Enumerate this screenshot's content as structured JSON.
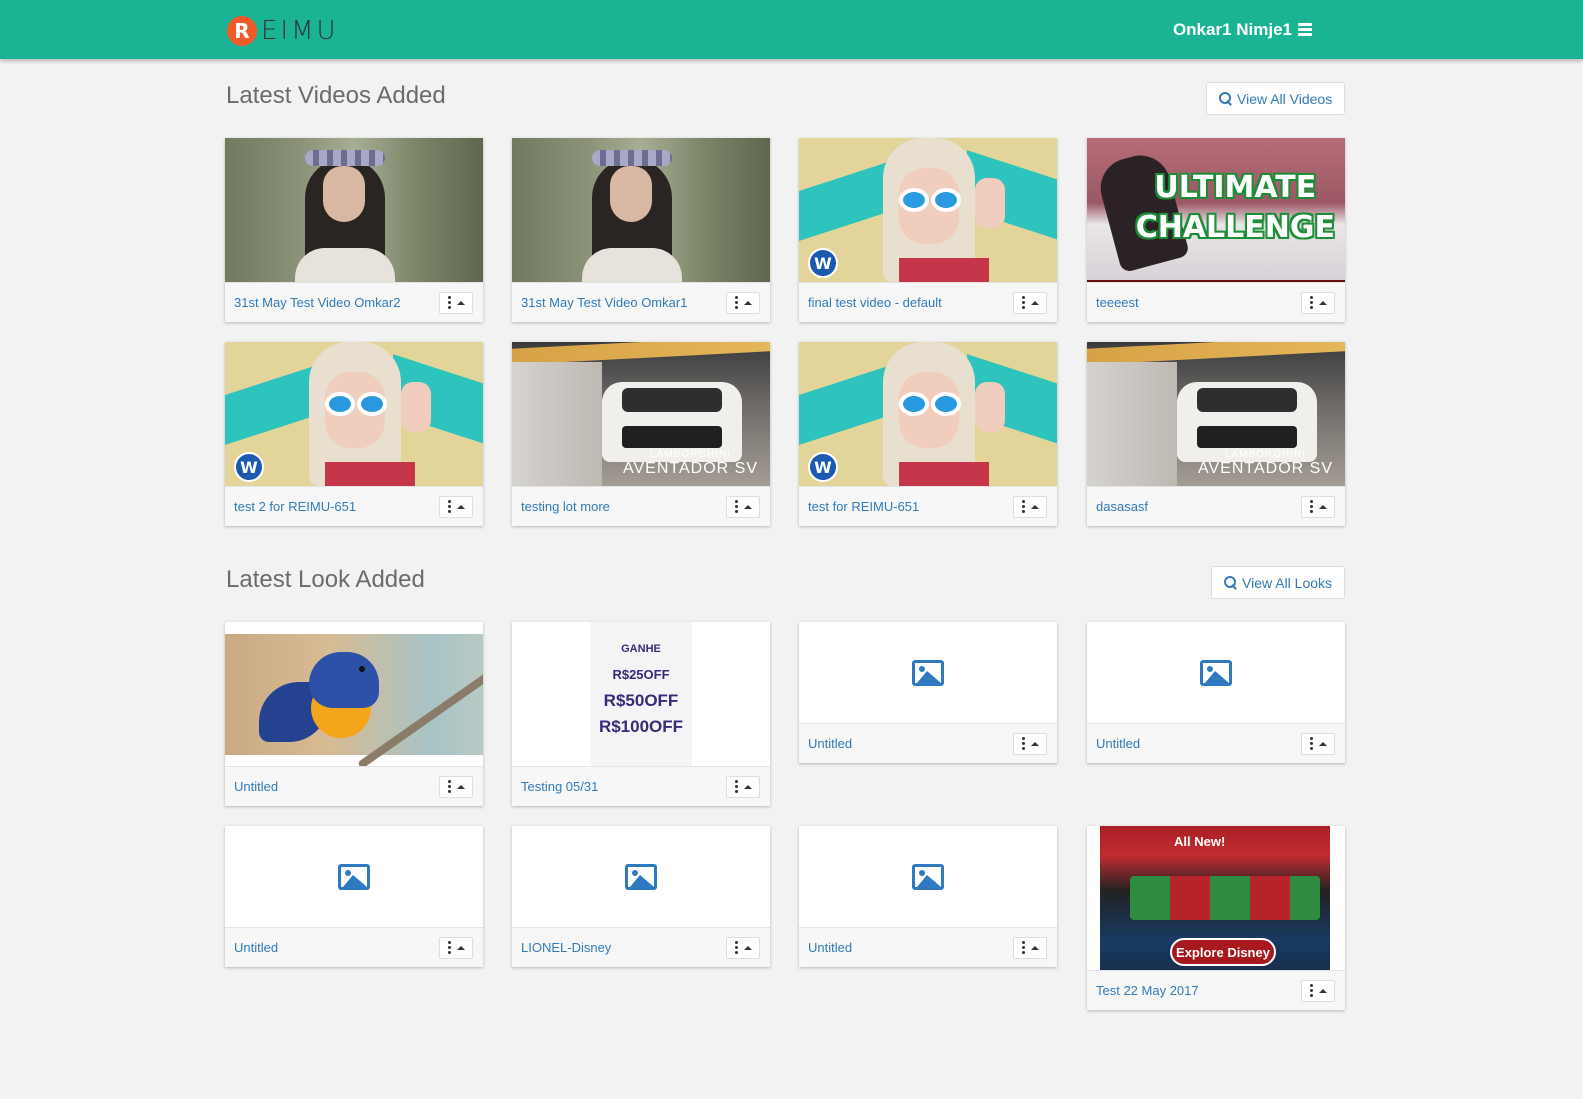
{
  "header": {
    "logo_letter": "R",
    "logo_text": "EIMU",
    "user_name": "Onkar1 Nimje1",
    "menu_icon": "bars-icon",
    "bg_color": "#1ab394"
  },
  "videos_section": {
    "title": "Latest Videos Added",
    "view_all_label": "View All Videos",
    "items": [
      {
        "title": "31st May Test Video Omkar2",
        "thumb": "forest-woman"
      },
      {
        "title": "31st May Test Video Omkar1",
        "thumb": "forest-woman"
      },
      {
        "title": "final test video - default",
        "thumb": "blonde-sunglasses"
      },
      {
        "title": "teeeest",
        "thumb": "ultimate-challenge"
      },
      {
        "title": "test 2 for REIMU-651",
        "thumb": "blonde-sunglasses"
      },
      {
        "title": "testing lot more",
        "thumb": "lamborghini"
      },
      {
        "title": "test for REIMU-651",
        "thumb": "blonde-sunglasses"
      },
      {
        "title": "dasasasf",
        "thumb": "lamborghini"
      }
    ],
    "overlay_texts": {
      "ultimate_line1": "ULTIMATE",
      "ultimate_line2": "CHALLENGE",
      "car_brand": "LAMBORGHINI",
      "car_model": "AVENTADOR SV",
      "wb_letter": "W"
    }
  },
  "looks_section": {
    "title": "Latest Look Added",
    "view_all_label": "View All Looks",
    "items": [
      {
        "title": "Untitled",
        "thumb": "bird"
      },
      {
        "title": "Testing 05/31",
        "thumb": "promo-poster"
      },
      {
        "title": "Untitled",
        "thumb": "image-icon"
      },
      {
        "title": "Untitled",
        "thumb": "image-icon"
      },
      {
        "title": "Untitled",
        "thumb": "image-icon"
      },
      {
        "title": "LIONEL-Disney",
        "thumb": "image-icon"
      },
      {
        "title": "Untitled",
        "thumb": "image-icon"
      },
      {
        "title": "Test 22 May 2017",
        "thumb": "disney-ad"
      }
    ],
    "promo_lines": [
      "GANHE",
      "R$25OFF",
      "R$50OFF",
      "R$100OFF"
    ],
    "disney_badge": "All New!",
    "disney_button": "Explore Disney"
  },
  "colors": {
    "link": "#337ab7",
    "accent": "#1ab394",
    "logo_badge": "#f05a28"
  }
}
